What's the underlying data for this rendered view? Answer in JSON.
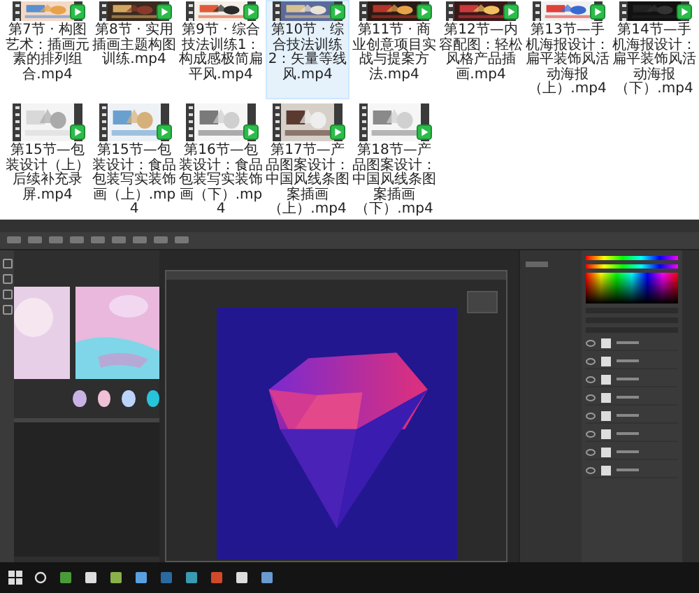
{
  "files": [
    {
      "name": "第7节 · 构图艺术：插画元素的排列组合.mp4",
      "selected": false
    },
    {
      "name": "第8节 · 实用插画主题构图训练.mp4",
      "selected": false
    },
    {
      "name": "第9节 · 综合技法训练1：构成感极简扁平风.mp4",
      "selected": false
    },
    {
      "name": "第10节 · 综合技法训练2：矢量等线风.mp4",
      "selected": true
    },
    {
      "name": "第11节 · 商业创意项目实战与提案方法.mp4",
      "selected": false
    },
    {
      "name": "第12节—内容配图：轻松风格产品插画.mp4",
      "selected": false
    },
    {
      "name": "第13节—手机海报设计：扁平装饰风活动海报（上）.mp4",
      "selected": false
    },
    {
      "name": "第14节—手机海报设计：扁平装饰风活动海报（下）.mp4",
      "selected": false
    },
    {
      "name": "第15节—包装设计（上）后续补充录屏.mp4",
      "selected": false
    },
    {
      "name": "第15节—包装设计：食品包装写实装饰画（上）.mp4",
      "selected": false
    },
    {
      "name": "第16节—包装设计：食品包装写实装饰画（下）.mp4",
      "selected": false
    },
    {
      "name": "第17节—产品图案设计：中国风线条图案插画（上）.mp4",
      "selected": false
    },
    {
      "name": "第18节—产品图案设计：中国风线条图案插画（下）.mp4",
      "selected": false
    }
  ],
  "swatches": [
    {
      "color": "#c9b3e6"
    },
    {
      "color": "#efc0d6"
    },
    {
      "color": "#bcd4fb"
    },
    {
      "color": "#28c4dc"
    }
  ]
}
